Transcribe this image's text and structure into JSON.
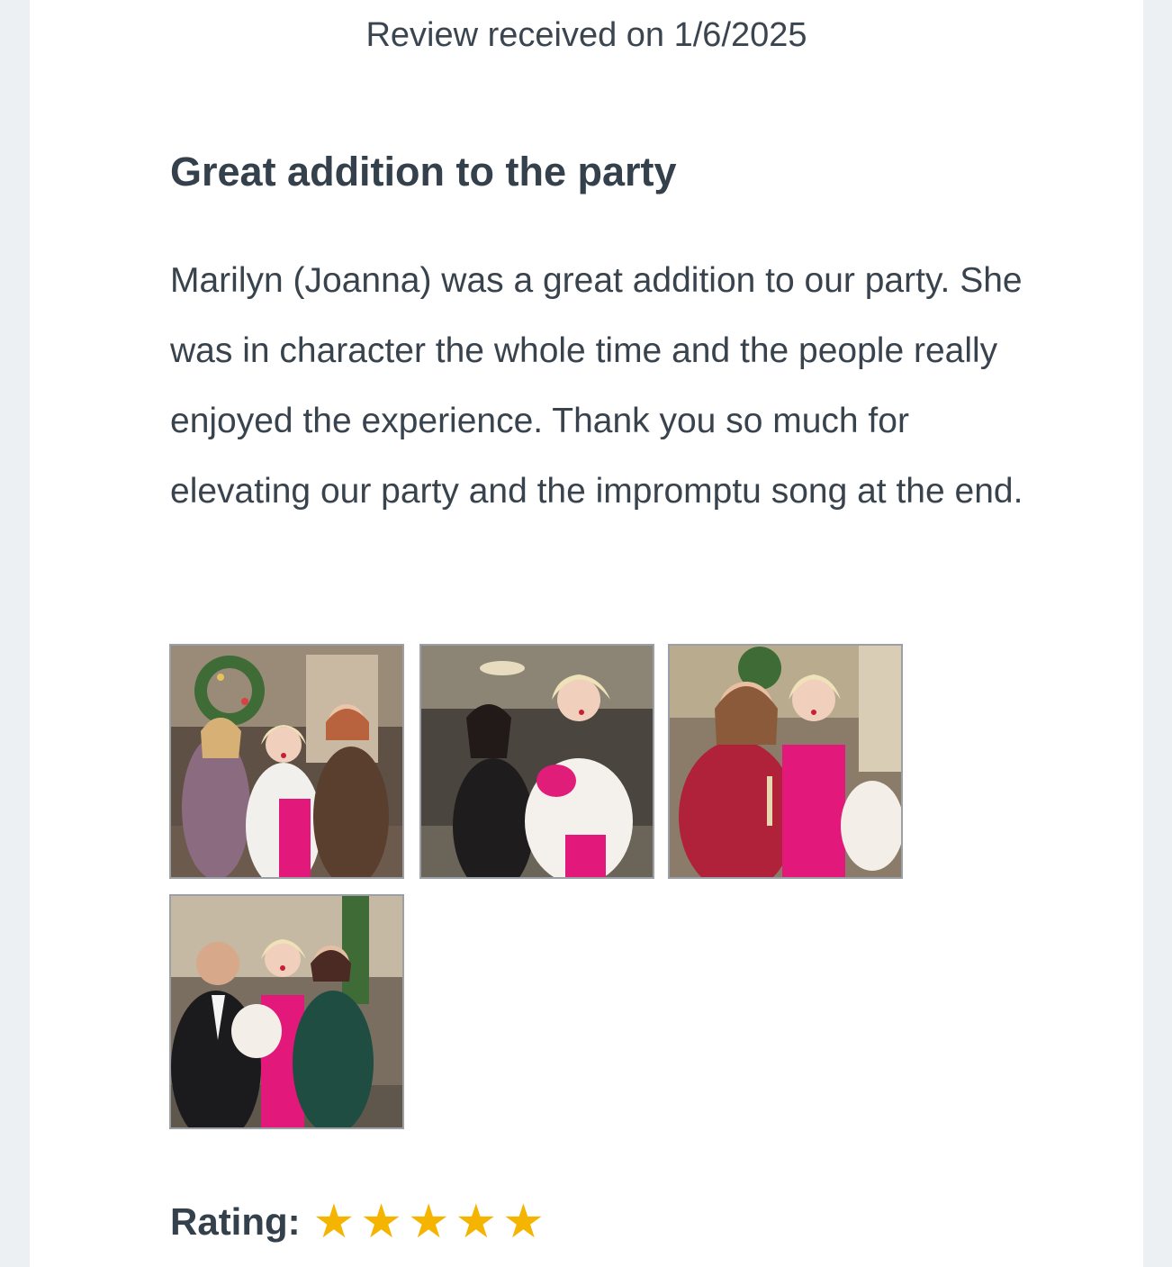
{
  "review": {
    "received": "Review received on 1/6/2025",
    "title": "Great addition to the party",
    "body": "Marilyn (Joanna) was a great addition to our party. She was in character the whole time and the people really enjoyed the experience. Thank you so much for elevating our party and the impromptu song at the end."
  },
  "photos": [
    {
      "icon": "photo-group-three-women"
    },
    {
      "icon": "photo-two-women-embrace"
    },
    {
      "icon": "photo-two-women-wine"
    },
    {
      "icon": "photo-group-three-people"
    }
  ],
  "rating": {
    "label": "Rating:",
    "value": 5,
    "max": 5,
    "star_glyph": "★",
    "star_color": "#f5b400"
  },
  "colors": {
    "page_background": "#ecf0f3",
    "card_background": "#ffffff",
    "text": "#39434d",
    "photo_border": "#9aa0a6"
  }
}
